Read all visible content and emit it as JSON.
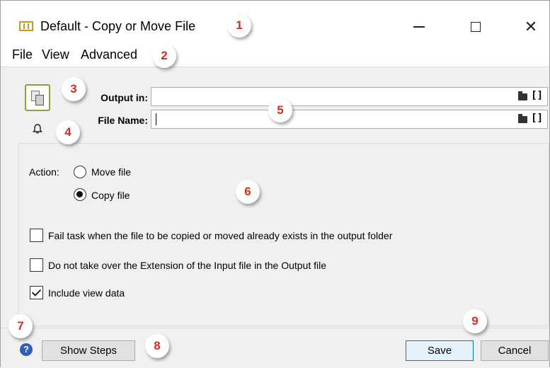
{
  "window": {
    "title": "Default - Copy or Move File",
    "minimize_icon": "minimize-icon",
    "maximize_icon": "maximize-icon",
    "close_icon": "close-icon",
    "close_glyph": "✕"
  },
  "menu": {
    "items": [
      "File",
      "View",
      "Advanced"
    ]
  },
  "fields": {
    "output_label": "Output in:",
    "output_value": "",
    "filename_label": "File Name:",
    "filename_value": "",
    "bracket_glyph": "[]"
  },
  "action": {
    "label": "Action:",
    "options": [
      {
        "label": "Move file",
        "selected": false
      },
      {
        "label": "Copy file",
        "selected": true
      }
    ]
  },
  "options": [
    {
      "label": "Fail task when the file to be copied or moved already exists in the output folder",
      "checked": false
    },
    {
      "label": "Do not take over the Extension of the Input file in the Output file",
      "checked": false
    },
    {
      "label": "Include view data",
      "checked": true
    }
  ],
  "footer": {
    "help_glyph": "?",
    "show_steps": "Show Steps",
    "save": "Save",
    "cancel": "Cancel"
  },
  "markers": [
    "1",
    "2",
    "3",
    "4",
    "5",
    "6",
    "7",
    "8",
    "9"
  ],
  "colors": {
    "marker_text": "#d82a20",
    "tool_border": "#8aa23a",
    "help_blue": "#2f5fb3",
    "primary_border": "#0078d7"
  }
}
